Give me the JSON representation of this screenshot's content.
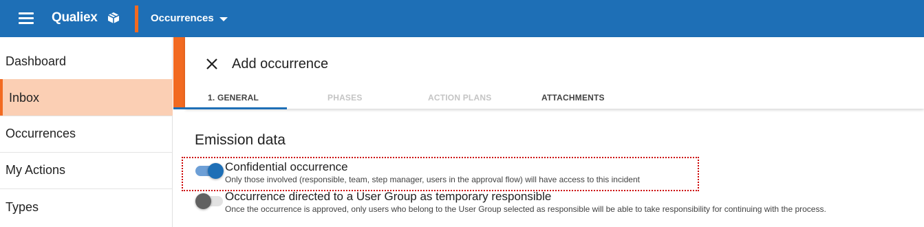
{
  "header": {
    "logo_text": "Qualiex",
    "module_label": "Occurrences",
    "brand_color": "#1e6fb6",
    "accent_color": "#f26a21"
  },
  "sidebar": {
    "items": [
      {
        "label": "Dashboard",
        "active": false
      },
      {
        "label": "Inbox",
        "active": true
      },
      {
        "label": "Occurrences",
        "active": false
      },
      {
        "label": "My Actions",
        "active": false
      },
      {
        "label": "Types",
        "active": false
      }
    ]
  },
  "panel": {
    "title": "Add occurrence",
    "tabs": [
      {
        "label": "1. GENERAL",
        "state": "active"
      },
      {
        "label": "PHASES",
        "state": "disabled"
      },
      {
        "label": "ACTION PLANS",
        "state": "disabled"
      },
      {
        "label": "ATTACHMENTS",
        "state": "enabled"
      }
    ]
  },
  "section": {
    "title": "Emission data",
    "options": [
      {
        "title": "Confidential occurrence",
        "description": "Only those involved (responsible, team, step manager, users in the approval flow) will have access to this incident",
        "checked": true
      },
      {
        "title": "Occurrence directed to a User Group as temporary responsible",
        "description": "Once the occurrence is approved, only users who belong to the User Group selected as responsible will be able to take responsibility for continuing with the process.",
        "checked": false
      }
    ]
  }
}
